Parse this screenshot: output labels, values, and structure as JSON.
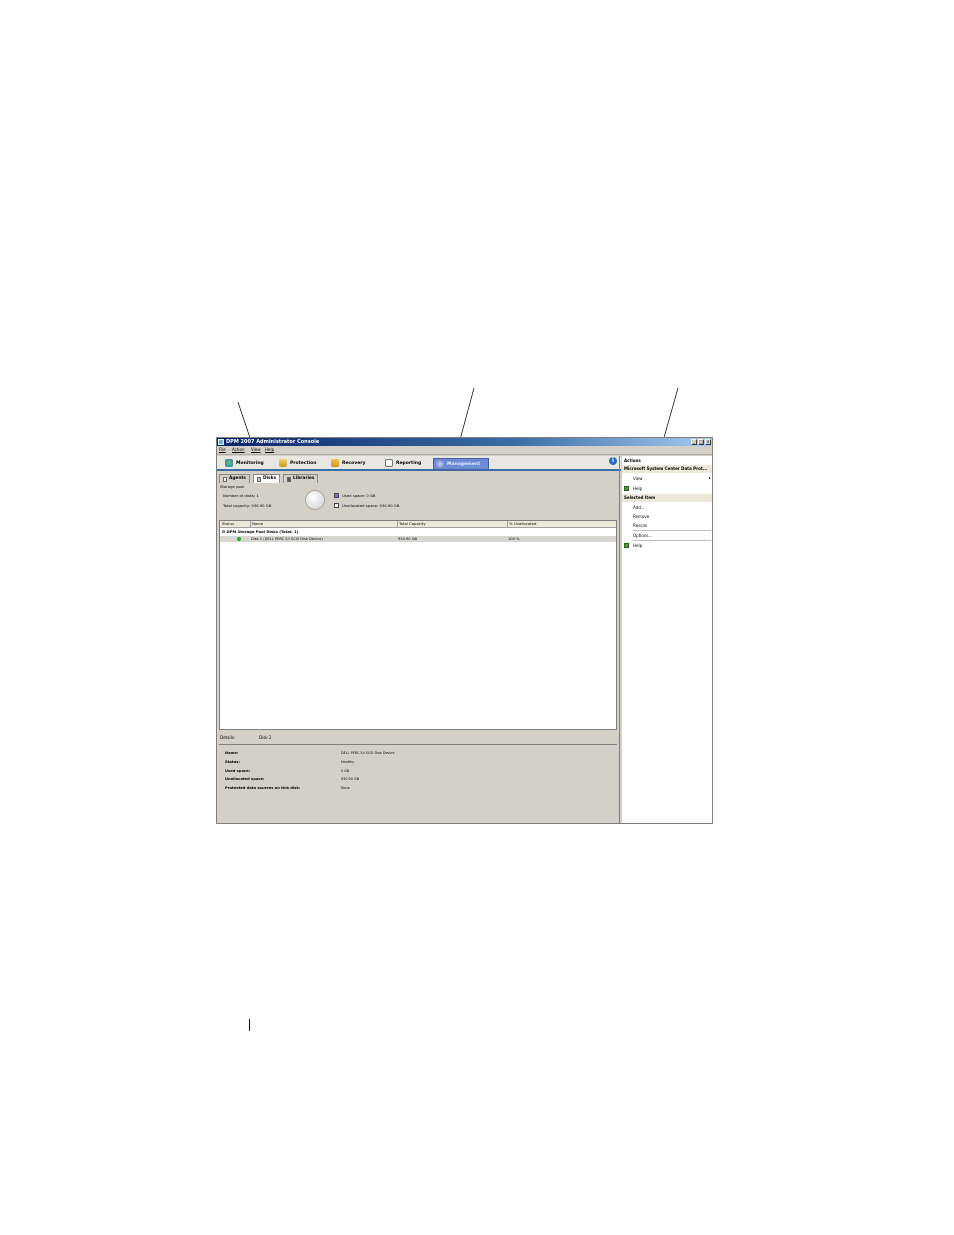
{
  "window": {
    "title": "DPM 2007 Administrator Console"
  },
  "menu": [
    "File",
    "Action",
    "View",
    "Help"
  ],
  "nav_tabs": [
    {
      "label": "Monitoring",
      "active": false
    },
    {
      "label": "Protection",
      "active": false
    },
    {
      "label": "Recovery",
      "active": false
    },
    {
      "label": "Reporting",
      "active": false
    },
    {
      "label": "Management",
      "active": true
    }
  ],
  "sub_tabs": [
    {
      "label": "Agents",
      "active": false
    },
    {
      "label": "Disks",
      "active": true
    },
    {
      "label": "Libraries",
      "active": false
    }
  ],
  "storage_pool": {
    "title": "Storage pool",
    "number_of_disks": "Number of disks: 1",
    "total_capacity": "Total capacity: 930.90 GB",
    "used_space": "Used space: 0 GB",
    "unallocated_space": "Unallocated space: 930.90 GB"
  },
  "grid": {
    "columns": [
      "Status",
      "Name",
      "Total Capacity",
      "% Unallocated"
    ],
    "group": "DPM Storage Pool Disks (Total: 1)",
    "rows": [
      {
        "name": "Disk 2 (DELL PERC 5/i SCSI Disk Device)",
        "capacity": "930.90 GB",
        "unallocated": "100 %"
      }
    ]
  },
  "details": {
    "label": "Details:",
    "value": "Disk 2",
    "fields": [
      {
        "key": "Name:",
        "value": "DELL PERC 5/i SCSI Disk Device"
      },
      {
        "key": "Status:",
        "value": "Healthy"
      },
      {
        "key": "Used space:",
        "value": "0 GB"
      },
      {
        "key": "Unallocated space:",
        "value": "930.90 GB"
      },
      {
        "key": "Protected data sources on this disk:",
        "value": "None"
      }
    ]
  },
  "actions": {
    "header": "Actions",
    "section1": "Microsoft System Center Data Prot...",
    "view": "View",
    "help1": "Help",
    "section2": "Selected Item",
    "add": "Add...",
    "remove": "Remove",
    "rescan": "Rescan",
    "options": "Options...",
    "help2": "Help"
  },
  "colors": {
    "title_bar": "#0a246a",
    "active_tab": "#6c8cd5",
    "accent": "#3a6ea5"
  }
}
